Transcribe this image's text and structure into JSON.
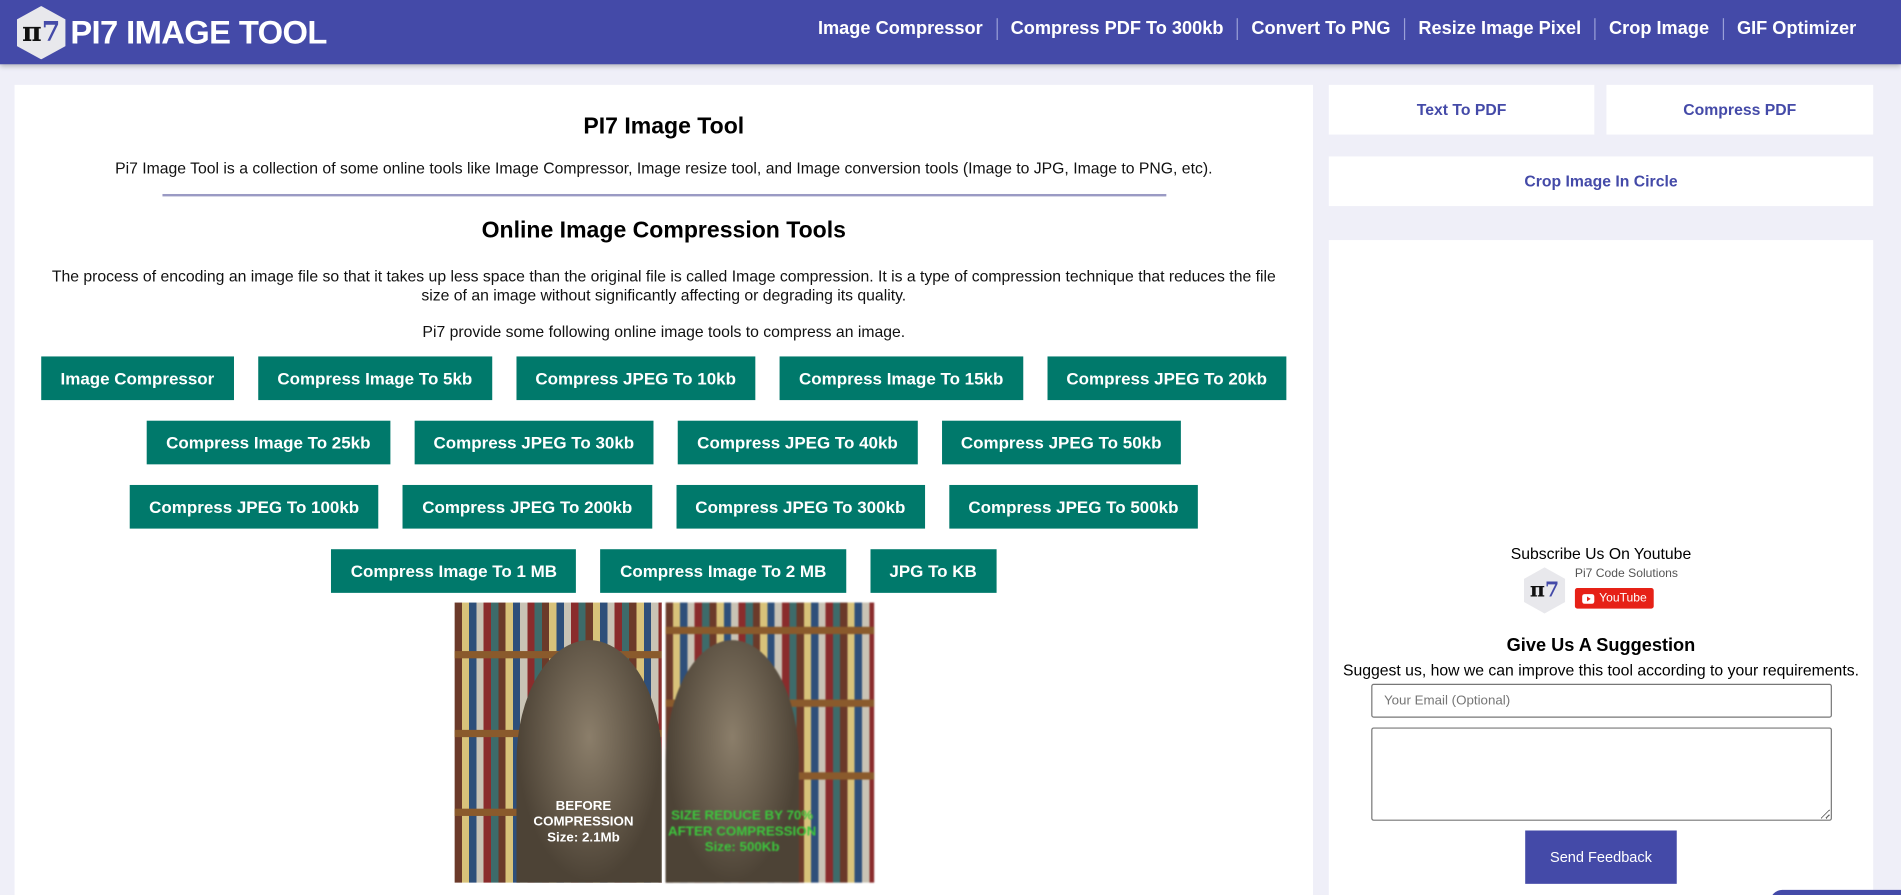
{
  "header": {
    "logo_text": "PI7 IMAGE TOOL",
    "logo_glyph": "π",
    "logo_glyph2": "7",
    "nav": [
      "Image Compressor",
      "Compress PDF To 300kb",
      "Convert To PNG",
      "Resize Image Pixel",
      "Crop Image",
      "GIF Optimizer"
    ]
  },
  "main": {
    "title": "PI7 Image Tool",
    "intro": "Pi7 Image Tool is a collection of some online tools like Image Compressor, Image resize tool, and Image conversion tools (Image to JPG, Image to PNG, etc).",
    "section_title": "Online Image Compression Tools",
    "description": "The process of encoding an image file so that it takes up less space than the original file is called Image compression. It is a type of compression technique that reduces the file size of an image without significantly affecting or degrading its quality.",
    "description2": "Pi7 provide some following online image tools to compress an image.",
    "button_rows": [
      [
        "Image Compressor",
        "Compress Image To 5kb",
        "Compress JPEG To 10kb",
        "Compress Image To 15kb",
        "Compress JPEG To 20kb"
      ],
      [
        "Compress Image To 25kb",
        "Compress JPEG To 30kb",
        "Compress JPEG To 40kb",
        "Compress JPEG To 50kb"
      ],
      [
        "Compress JPEG To 100kb",
        "Compress JPEG To 200kb",
        "Compress JPEG To 300kb",
        "Compress JPEG To 500kb"
      ],
      [
        "Compress Image To 1 MB",
        "Compress Image To 2 MB",
        "JPG To KB"
      ]
    ],
    "image": {
      "before_label": "BEFORE COMPRESSION",
      "before_size": "Size: 2.1Mb",
      "after_label": "SIZE REDUCE BY 70%",
      "after_label2": "AFTER COMPRESSION",
      "after_size": "Size: 500Kb"
    }
  },
  "sidebar": {
    "links": [
      "Text To PDF",
      "Compress PDF",
      "Crop Image In Circle"
    ],
    "youtube": {
      "heading": "Subscribe Us On Youtube",
      "channel": "Pi7 Code Solutions",
      "button": "YouTube"
    },
    "suggestion": {
      "title": "Give Us A Suggestion",
      "text": "Suggest us, how we can improve this tool according to your requirements.",
      "email_placeholder": "Your Email (Optional)",
      "submit": "Send Feedback"
    }
  }
}
